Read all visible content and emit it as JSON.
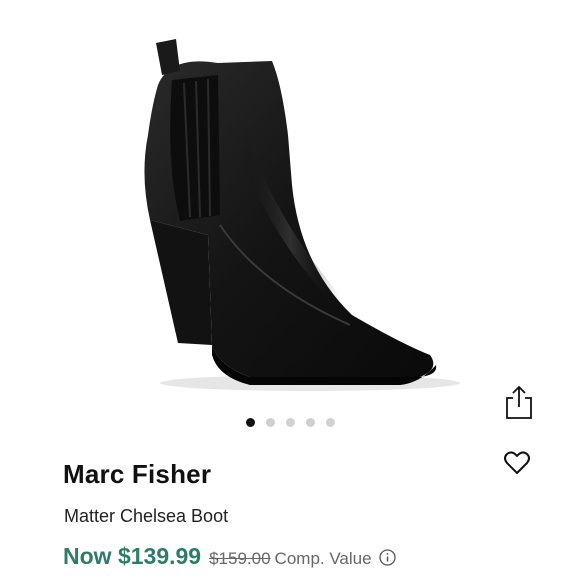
{
  "product": {
    "brand": "Marc Fisher",
    "name": "Matter Chelsea Boot",
    "price_now": "Now $139.99",
    "price_original": "$159.00",
    "comp_value_label": "Comp. Value"
  },
  "carousel": {
    "total_images": 5,
    "active_index": 0
  },
  "icons": {
    "share": "share-icon",
    "like": "heart-icon",
    "info": "info-icon"
  },
  "colors": {
    "price_now": "#2e7d6b",
    "active_dot": "#111111",
    "inactive_dot": "#d0d0d0"
  }
}
